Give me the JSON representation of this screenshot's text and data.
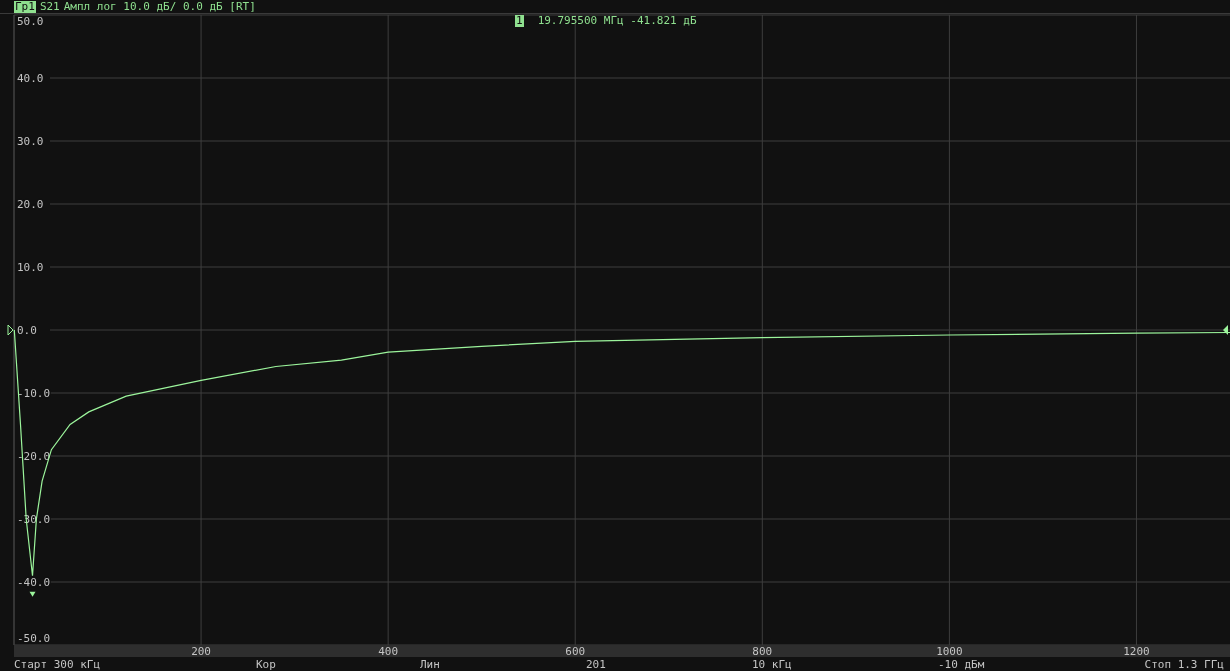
{
  "trace": {
    "label": "Гр1",
    "selected": true,
    "title": "Ампл лог 10.0 дБ/ 0.0 дБ [RT]"
  },
  "marker_readout": {
    "number": "1",
    "text": "19.795500 МГц -41.821 дБ"
  },
  "chart_data": {
    "type": "line",
    "grid": true,
    "xlim": [
      0,
      1300
    ],
    "ylim": [
      -50,
      50
    ],
    "xticks": [
      200,
      400,
      600,
      800,
      1000,
      1200
    ],
    "yticks": [
      {
        "value": 50,
        "label": "50.0"
      },
      {
        "value": 40,
        "label": "40.0"
      },
      {
        "value": 30,
        "label": "30.0"
      },
      {
        "value": 20,
        "label": "20.0"
      },
      {
        "value": 10,
        "label": "10.0"
      },
      {
        "value": 0,
        "label": "0.0"
      },
      {
        "value": -10,
        "label": "-10.0"
      },
      {
        "value": -20,
        "label": "-20.0"
      },
      {
        "value": -30,
        "label": "-30.0"
      },
      {
        "value": -40,
        "label": "-40.0"
      },
      {
        "value": -50,
        "label": "-50.0"
      }
    ],
    "x": [
      0.3,
      7,
      13,
      19.8,
      24,
      30,
      40,
      60,
      80,
      120,
      200,
      280,
      350,
      400,
      500,
      600,
      800,
      1000,
      1200,
      1300
    ],
    "series": [
      {
        "name": "S21",
        "color": "#9cf59c",
        "values": [
          0,
          -15,
          -30,
          -39,
          -30,
          -24,
          -19,
          -15,
          -13,
          -10.5,
          -8,
          -5.8,
          -4.8,
          -3.5,
          -2.6,
          -1.8,
          -1.2,
          -0.8,
          -0.5,
          -0.4
        ]
      }
    ]
  },
  "status_bar": [
    "Старт 300 кГц",
    "Кор",
    "Лин",
    "201",
    "10 кГц",
    "-10 дБм",
    "Стоп 1.3 ГГц"
  ]
}
